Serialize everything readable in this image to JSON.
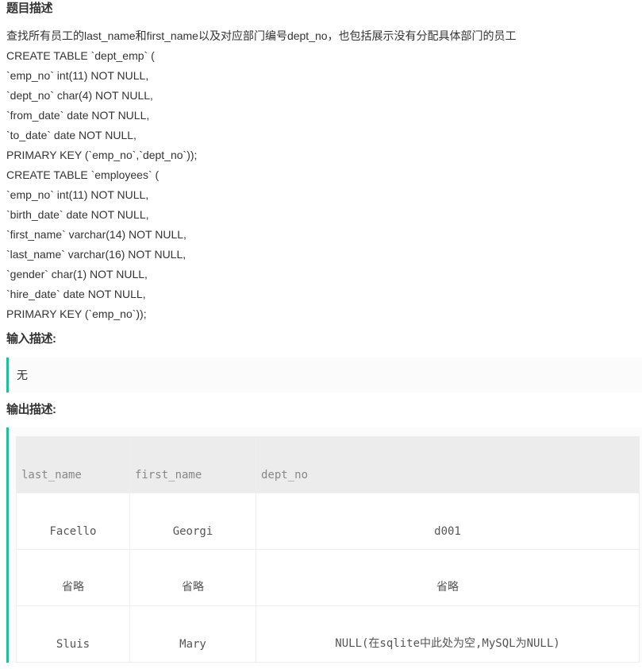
{
  "problem_title": "题目描述",
  "description_lines": [
    "查找所有员工的last_name和first_name以及对应部门编号dept_no，也包括展示没有分配具体部门的员工",
    "CREATE TABLE `dept_emp` (",
    "`emp_no` int(11) NOT NULL,",
    "`dept_no` char(4) NOT NULL,",
    "`from_date` date NOT NULL,",
    "`to_date` date NOT NULL,",
    "PRIMARY KEY (`emp_no`,`dept_no`));",
    "CREATE TABLE `employees` (",
    "`emp_no` int(11) NOT NULL,",
    "`birth_date` date NOT NULL,",
    "`first_name` varchar(14) NOT NULL,",
    "`last_name` varchar(16) NOT NULL,",
    "`gender` char(1) NOT NULL,",
    "`hire_date` date NOT NULL,",
    "PRIMARY KEY (`emp_no`));"
  ],
  "input_title": "输入描述:",
  "input_value": "无",
  "output_title": "输出描述:",
  "output_table": {
    "headers": [
      "last_name",
      "first_name",
      "dept_no"
    ],
    "rows": [
      [
        "Facello",
        "Georgi",
        "d001"
      ],
      [
        "省略",
        "省略",
        "省略"
      ],
      [
        "Sluis",
        "Mary",
        "NULL(在sqlite中此处为空,MySQL为NULL)"
      ]
    ]
  },
  "colors": {
    "accent": "#25bb9b",
    "header_bg": "#ececec"
  }
}
